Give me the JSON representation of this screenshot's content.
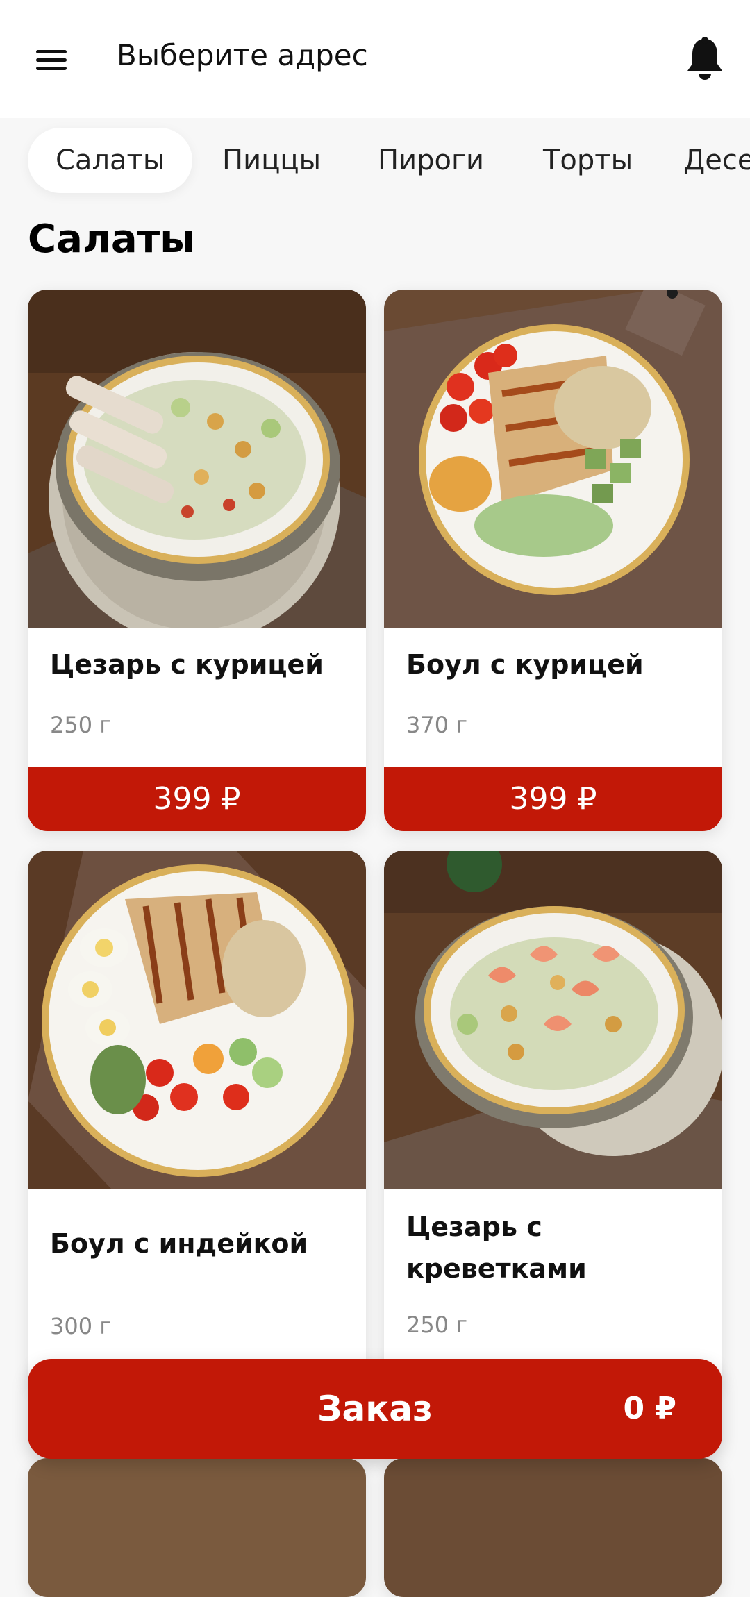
{
  "header": {
    "menu_icon": "hamburger-menu-icon",
    "title": "Выберите адрес",
    "notification_icon": "bell-icon"
  },
  "tabs": [
    {
      "label": "Салаты",
      "active": true
    },
    {
      "label": "Пиццы",
      "active": false
    },
    {
      "label": "Пироги",
      "active": false
    },
    {
      "label": "Торты",
      "active": false
    },
    {
      "label": "Десе",
      "active": false
    }
  ],
  "section": {
    "title": "Салаты"
  },
  "products": [
    {
      "name": "Цезарь с курицей",
      "weight": "250 г",
      "price": "399 ₽",
      "image": "caesar-chicken-salad-photo"
    },
    {
      "name": "Боул с курицей",
      "weight": "370 г",
      "price": "399 ₽",
      "image": "chicken-bowl-photo"
    },
    {
      "name": "Боул с индейкой",
      "weight": "300 г",
      "image": "turkey-bowl-photo"
    },
    {
      "name": "Цезарь с креветками",
      "weight": "250 г",
      "image": "caesar-shrimp-salad-photo"
    }
  ],
  "order_bar": {
    "label": "Заказ",
    "total": "0 ₽"
  },
  "colors": {
    "accent": "#c21807",
    "background": "#f7f7f7",
    "card": "#ffffff",
    "secondary_text": "#888888"
  }
}
